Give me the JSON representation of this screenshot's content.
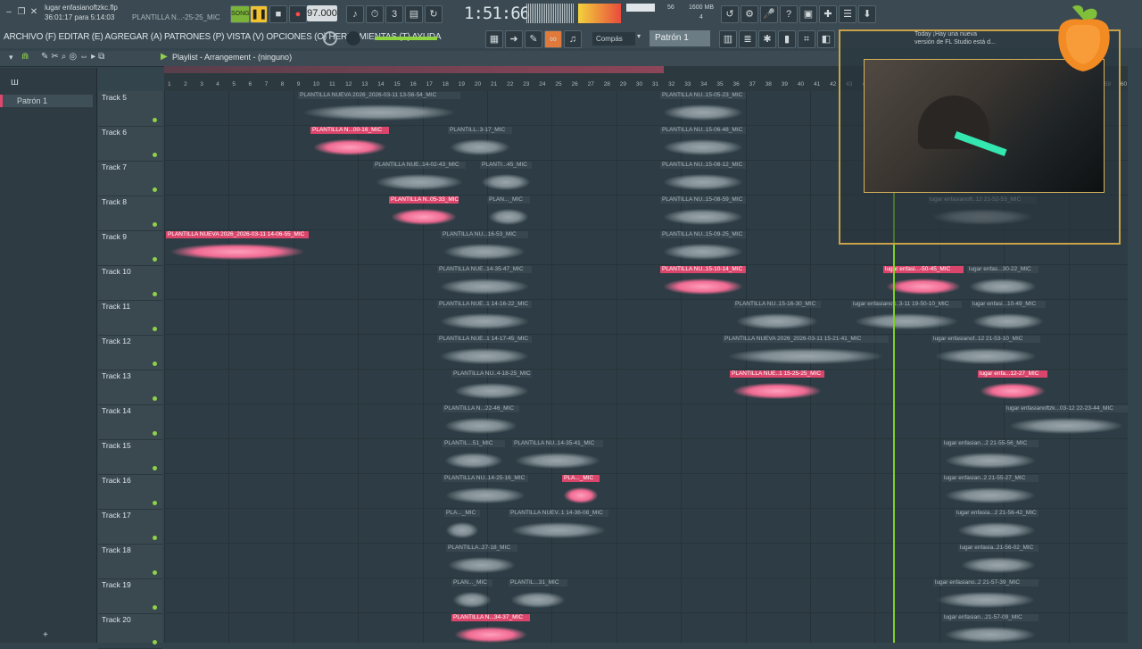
{
  "window": {
    "title": "lugar enfasianoftzkc.flp",
    "subtitle": "36:01:17 para 5:14:03",
    "project_hint": "PLANTILLA N...-25-25_MIC",
    "minimize": "–",
    "restore": "❐",
    "close": "✕"
  },
  "transport": {
    "song_mode": "SONG",
    "play": "▶",
    "stop": "■",
    "record": "●",
    "tempo": "97.000",
    "time": "1:51:66",
    "cpu_label": "56",
    "mem_label": "1600 MB",
    "voices": "4"
  },
  "menu": {
    "items": "ARCHIVO (F) EDITAR (E) AGREGAR (A) PATRONES (P) VISTA (V) OPCIONES (O) HERRAMIENTAS (T) AYUDA"
  },
  "snap": {
    "value": "Compás"
  },
  "pattern": {
    "value": "Patrón 1"
  },
  "playlist": {
    "title": "Playlist - Arrangement - (ninguno)"
  },
  "sidebar": {
    "items": [
      {
        "label": "Patrón 1"
      }
    ]
  },
  "notification": {
    "line1": "Today ¡Hay una nueva",
    "line2": "versión de FL Studio está d..."
  },
  "ruler": {
    "ticks": [
      "1",
      "2",
      "3",
      "4",
      "5",
      "6",
      "7",
      "8",
      "9",
      "10",
      "11",
      "12",
      "13",
      "14",
      "15",
      "16",
      "17",
      "18",
      "19",
      "20",
      "21",
      "22",
      "23",
      "24",
      "25",
      "26",
      "27",
      "28",
      "29",
      "30",
      "31",
      "32",
      "33",
      "34",
      "35",
      "36",
      "37",
      "38",
      "39",
      "40",
      "41",
      "42",
      "43",
      "44",
      "45",
      "46",
      "47",
      "48",
      "49",
      "50",
      "51",
      "52",
      "53",
      "54",
      "55",
      "56",
      "57",
      "58",
      "59",
      "60"
    ]
  },
  "tracks": [
    {
      "label": "Track 5"
    },
    {
      "label": "Track 6"
    },
    {
      "label": "Track 7"
    },
    {
      "label": "Track 8"
    },
    {
      "label": "Track 9"
    },
    {
      "label": "Track 10"
    },
    {
      "label": "Track 11"
    },
    {
      "label": "Track 12"
    },
    {
      "label": "Track 13"
    },
    {
      "label": "Track 14"
    },
    {
      "label": "Track 15"
    },
    {
      "label": "Track 16"
    },
    {
      "label": "Track 17"
    },
    {
      "label": "Track 18"
    },
    {
      "label": "Track 19"
    },
    {
      "label": "Track 20"
    }
  ],
  "clips": [
    {
      "name": "PLANTILLA NUEVA 2026_2026-03-11 13-56-54_MIC",
      "style": "gray"
    },
    {
      "name": "PLANTILLA NU..15-05-23_MIC",
      "style": "gray"
    },
    {
      "name": "PLANTILLA N...00-16_MIC",
      "style": "pink"
    },
    {
      "name": "PLANTILL..3-17_MIC",
      "style": "gray"
    },
    {
      "name": "PLANTILLA NU..15-06-48_MIC",
      "style": "gray"
    },
    {
      "name": "PLANTILLA NUE..14-02-43_MIC",
      "style": "gray"
    },
    {
      "name": "PLANTI...45_MIC",
      "style": "gray"
    },
    {
      "name": "PLANTILLA NU..15-08-12_MIC",
      "style": "gray"
    },
    {
      "name": "PLANTILLA N..05-33_MIC",
      "style": "pink"
    },
    {
      "name": "PLAN..._MIC",
      "style": "gray"
    },
    {
      "name": "PLANTILLA NU..15-08-59_MIC",
      "style": "gray"
    },
    {
      "name": "lugar enfasianoft..12 21-52-53_MIC",
      "style": "gray"
    },
    {
      "name": "PLANTILLA NUEVA 2026_2026-03-11 14-06-55_MIC",
      "style": "pink"
    },
    {
      "name": "PLANTILLA NU...16-53_MIC",
      "style": "gray"
    },
    {
      "name": "PLANTILLA NU..15-09-25_MIC",
      "style": "gray"
    },
    {
      "name": "PLANTILLA NUE..14-35-47_MIC",
      "style": "gray"
    },
    {
      "name": "PLANTILLA NU..15-10-14_MIC",
      "style": "pink"
    },
    {
      "name": "lugar enfasi...-50-45_MIC",
      "style": "pink"
    },
    {
      "name": "lugar enfas...30-22_MIC",
      "style": "gray"
    },
    {
      "name": "PLANTILLA NUE..1 14-16-22_MIC",
      "style": "gray"
    },
    {
      "name": "PLANTILLA NU..15-16-30_MIC",
      "style": "gray"
    },
    {
      "name": "lugar enfasianoft..3-11 19-50-10_MIC",
      "style": "gray"
    },
    {
      "name": "lugar enfasi...10-49_MIC",
      "style": "gray"
    },
    {
      "name": "PLANTILLA NUE..1 14-17-45_MIC",
      "style": "gray"
    },
    {
      "name": "PLANTILLA NUEVA 2026_2026-03-11 15-21-41_MIC",
      "style": "gray"
    },
    {
      "name": "lugar enfasianof..12 21-53-10_MIC",
      "style": "gray"
    },
    {
      "name": "PLANTILLA NU..4-18-25_MIC",
      "style": "gray"
    },
    {
      "name": "PLANTILLA NUE..1 15-25-25_MIC",
      "style": "pink"
    },
    {
      "name": "lugar enfa...12-27_MIC",
      "style": "pink"
    },
    {
      "name": "PLANTILLA N...22-46_MIC",
      "style": "gray"
    },
    {
      "name": "lugar enfasianoftzk...03-12 22-23-44_MIC",
      "style": "gray"
    },
    {
      "name": "PLANTIL...51_MIC",
      "style": "gray"
    },
    {
      "name": "PLANTILLA NU..14-35-41_MIC",
      "style": "gray"
    },
    {
      "name": "lugar enfasian...2 21-55-56_MIC",
      "style": "gray"
    },
    {
      "name": "PLANTILLA NU..14-25-16_MIC",
      "style": "gray"
    },
    {
      "name": "PLA..._MIC",
      "style": "pink"
    },
    {
      "name": "lugar enfasian..2 21-55-27_MIC",
      "style": "gray"
    },
    {
      "name": "PLA..._MIC",
      "style": "gray"
    },
    {
      "name": "PLANTILLA NUEV..1 14-36-08_MIC",
      "style": "gray"
    },
    {
      "name": "lugar enfasia...2 21-56-42_MIC",
      "style": "gray"
    },
    {
      "name": "PLANTILLA..27-18_MIC",
      "style": "gray"
    },
    {
      "name": "lugar enfasia..21-56-02_MIC",
      "style": "gray"
    },
    {
      "name": "PLAN..._MIC",
      "style": "gray"
    },
    {
      "name": "PLANTIL...31_MIC",
      "style": "gray"
    },
    {
      "name": "lugar enfasiano..2 21-57-39_MIC",
      "style": "gray"
    },
    {
      "name": "PLANTILLA N...34-37_MIC",
      "style": "pink"
    },
    {
      "name": "lugar enfasian...21-57-09_MIC",
      "style": "gray"
    }
  ]
}
